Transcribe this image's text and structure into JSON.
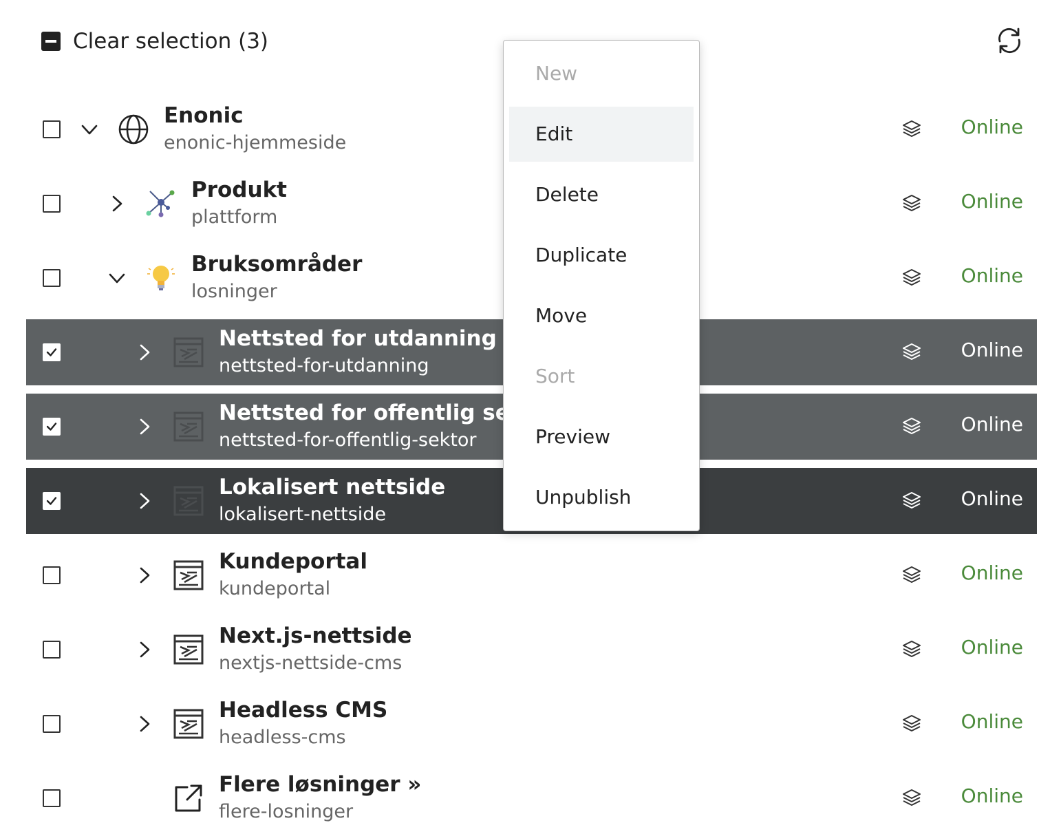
{
  "toolbar": {
    "clear_selection": "Clear selection (3)"
  },
  "rows": [
    {
      "title": "Enonic",
      "path": "enonic-hjemmeside",
      "status": "Online"
    },
    {
      "title": "Produkt",
      "path": "plattform",
      "status": "Online"
    },
    {
      "title": "Bruksområder",
      "path": "losninger",
      "status": "Online"
    },
    {
      "title": "Nettsted for utdanning",
      "path": "nettsted-for-utdanning",
      "status": "Online"
    },
    {
      "title": "Nettsted for offentlig sektor",
      "path": "nettsted-for-offentlig-sektor",
      "status": "Online"
    },
    {
      "title": "Lokalisert nettside",
      "path": "lokalisert-nettside",
      "status": "Online"
    },
    {
      "title": "Kundeportal",
      "path": "kundeportal",
      "status": "Online"
    },
    {
      "title": "Next.js-nettside",
      "path": "nextjs-nettside-cms",
      "status": "Online"
    },
    {
      "title": "Headless CMS",
      "path": "headless-cms",
      "status": "Online"
    },
    {
      "title": "Flere løsninger »",
      "path": "flere-losninger",
      "status": "Online"
    }
  ],
  "context_menu": {
    "items": [
      {
        "label": "New",
        "enabled": false
      },
      {
        "label": "Edit",
        "enabled": true,
        "highlighted": true
      },
      {
        "label": "Delete",
        "enabled": true
      },
      {
        "label": "Duplicate",
        "enabled": true
      },
      {
        "label": "Move",
        "enabled": true
      },
      {
        "label": "Sort",
        "enabled": false
      },
      {
        "label": "Preview",
        "enabled": true
      },
      {
        "label": "Unpublish",
        "enabled": true
      }
    ]
  },
  "colors": {
    "status_online": "#4a8a3a",
    "selected_row": "#5d6163",
    "focused_row": "#3b3e40",
    "menu_highlight": "#f1f3f4"
  },
  "icons": [
    "clear-selection-icon",
    "refresh-icon",
    "globe-icon",
    "network-icon",
    "lightbulb-icon",
    "site-icon",
    "external-link-icon",
    "layers-icon",
    "chevron-down-icon",
    "chevron-right-icon",
    "checkmark-icon"
  ]
}
